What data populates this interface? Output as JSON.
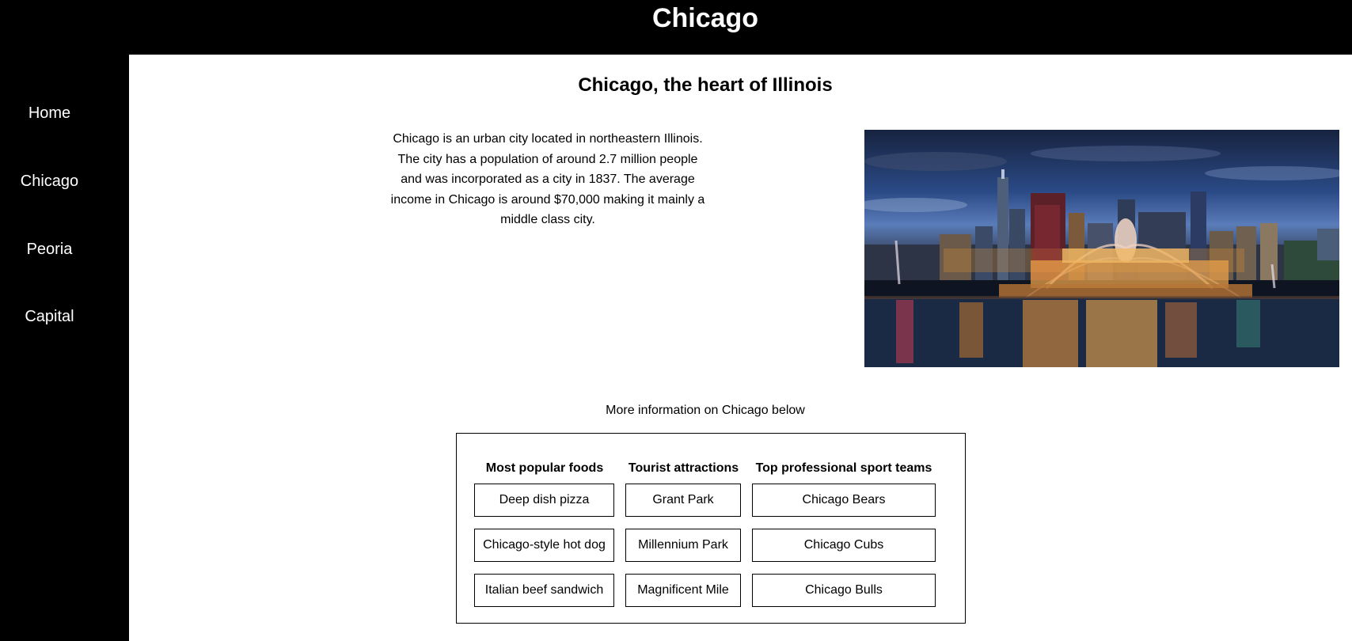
{
  "header": {
    "title": "Chicago"
  },
  "nav": {
    "items": [
      {
        "label": "Home"
      },
      {
        "label": "Chicago"
      },
      {
        "label": "Peoria"
      },
      {
        "label": "Capital"
      }
    ]
  },
  "main": {
    "heading": "Chicago, the heart of Illinois",
    "intro": "Chicago is an urban city located in northeastern Illinois. The city has a population of around 2.7 million people and was incorporated as a city in 1837. The average income in Chicago is around $70,000 making it mainly a middle class city.",
    "more_info": "More information on Chicago below",
    "info_table": {
      "columns": [
        {
          "header": "Most popular foods",
          "items": [
            "Deep dish pizza",
            "Chicago-style hot dog",
            "Italian beef sandwich"
          ]
        },
        {
          "header": "Tourist attractions",
          "items": [
            "Grant Park",
            "Millennium Park",
            "Magnificent Mile"
          ]
        },
        {
          "header": "Top professional sport teams",
          "items": [
            "Chicago Bears",
            "Chicago Cubs",
            "Chicago Bulls"
          ]
        }
      ]
    }
  }
}
